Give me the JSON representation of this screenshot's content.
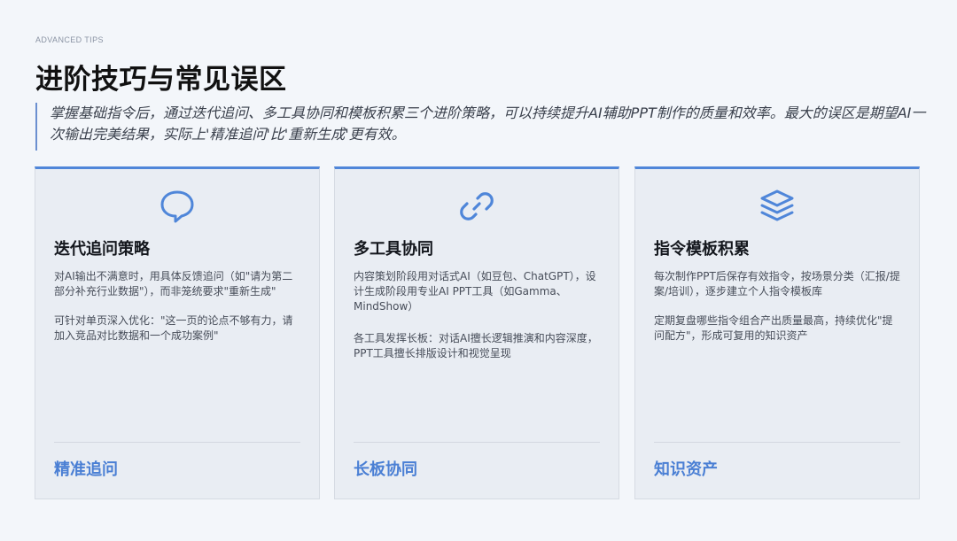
{
  "header": {
    "kicker": "ADVANCED TIPS",
    "title": "进阶技巧与常见误区",
    "lead": "掌握基础指令后，通过迭代追问、多工具协同和模板积累三个进阶策略，可以持续提升AI辅助PPT制作的质量和效率。最大的误区是期望AI一次输出完美结果，实际上'精准追问'比'重新生成'更有效。"
  },
  "colors": {
    "accent": "#4f86d9",
    "card_bg": "#e9edf3",
    "page_bg": "#f3f6fa"
  },
  "cards": [
    {
      "icon": "chat-bubble-icon",
      "title": "迭代追问策略",
      "paragraphs": [
        "对AI输出不满意时，用具体反馈追问（如\"请为第二部分补充行业数据\"），而非笼统要求\"重新生成\"",
        "可针对单页深入优化：\"这一页的论点不够有力，请加入竞品对比数据和一个成功案例\""
      ],
      "tag": "精准追问"
    },
    {
      "icon": "link-icon",
      "title": "多工具协同",
      "paragraphs": [
        "内容策划阶段用对话式AI（如豆包、ChatGPT），设计生成阶段用专业AI PPT工具（如Gamma、MindShow）",
        "各工具发挥长板：对话AI擅长逻辑推演和内容深度，PPT工具擅长排版设计和视觉呈现"
      ],
      "tag": "长板协同"
    },
    {
      "icon": "layers-icon",
      "title": "指令模板积累",
      "paragraphs": [
        "每次制作PPT后保存有效指令，按场景分类（汇报/提案/培训），逐步建立个人指令模板库",
        "定期复盘哪些指令组合产出质量最高，持续优化\"提问配方\"，形成可复用的知识资产"
      ],
      "tag": "知识资产"
    }
  ]
}
